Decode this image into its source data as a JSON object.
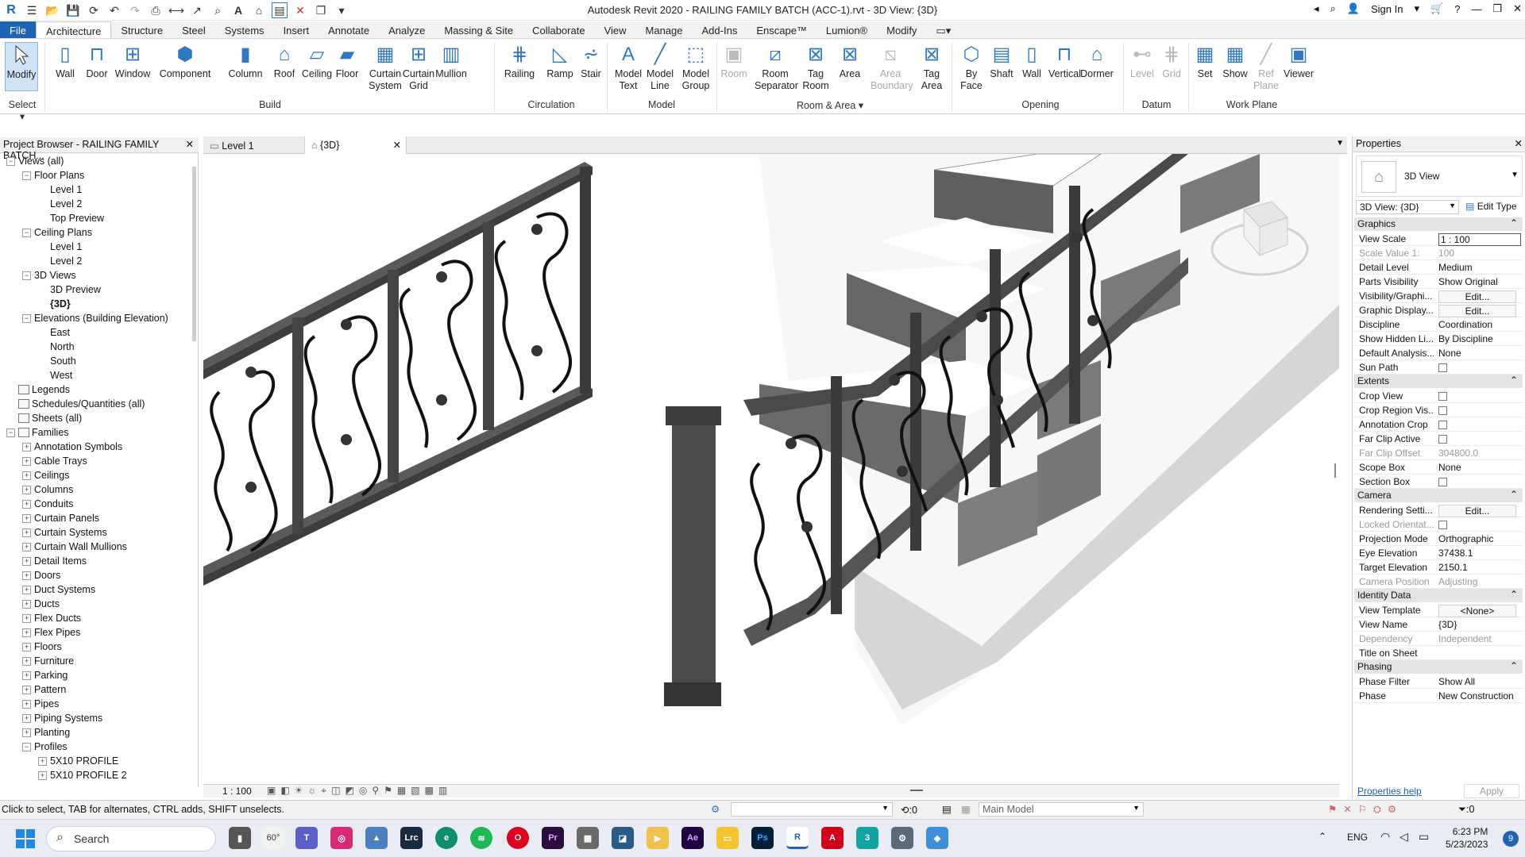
{
  "app": {
    "title": "Autodesk Revit 2020 - RAILING FAMILY BATCH (ACC-1).rvt - 3D View: {3D}",
    "sign_in": "Sign In"
  },
  "ribbon_tabs": [
    "File",
    "Architecture",
    "Structure",
    "Steel",
    "Systems",
    "Insert",
    "Annotate",
    "Analyze",
    "Massing & Site",
    "Collaborate",
    "View",
    "Manage",
    "Add-Ins",
    "Enscape™",
    "Lumion®",
    "Modify"
  ],
  "ribbon": {
    "select_label": "Select",
    "modify": "Modify",
    "build": {
      "label": "Build",
      "tools": [
        "Wall",
        "Door",
        "Window",
        "Component",
        "Column",
        "Roof",
        "Ceiling",
        "Floor",
        "Curtain System",
        "Curtain Grid",
        "Mullion"
      ]
    },
    "circulation": {
      "label": "Circulation",
      "tools": [
        "Railing",
        "Ramp",
        "Stair"
      ]
    },
    "model": {
      "label": "Model",
      "tools": [
        "Model Text",
        "Model Line",
        "Model Group"
      ]
    },
    "room_area": {
      "label": "Room & Area",
      "tools": [
        "Room",
        "Room Separator",
        "Tag Room",
        "Area",
        "Area Boundary",
        "Tag Area"
      ]
    },
    "opening": {
      "label": "Opening",
      "tools": [
        "By Face",
        "Shaft",
        "Wall",
        "Vertical",
        "Dormer"
      ]
    },
    "datum": {
      "label": "Datum",
      "tools": [
        "Level",
        "Grid"
      ]
    },
    "work_plane": {
      "label": "Work Plane",
      "tools": [
        "Set",
        "Show",
        "Ref Plane",
        "Viewer"
      ]
    }
  },
  "project_browser": {
    "title": "Project Browser - RAILING FAMILY BATCH...",
    "tree": [
      {
        "label": "Views (all)",
        "level": 0,
        "exp": "-"
      },
      {
        "label": "Floor Plans",
        "level": 1,
        "exp": "-"
      },
      {
        "label": "Level 1",
        "level": 2,
        "exp": ""
      },
      {
        "label": "Level 2",
        "level": 2,
        "exp": ""
      },
      {
        "label": "Top Preview",
        "level": 2,
        "exp": ""
      },
      {
        "label": "Ceiling Plans",
        "level": 1,
        "exp": "-"
      },
      {
        "label": "Level 1",
        "level": 2,
        "exp": ""
      },
      {
        "label": "Level 2",
        "level": 2,
        "exp": ""
      },
      {
        "label": "3D Views",
        "level": 1,
        "exp": "-"
      },
      {
        "label": "3D Preview",
        "level": 2,
        "exp": ""
      },
      {
        "label": "{3D}",
        "level": 2,
        "exp": "",
        "bold": true
      },
      {
        "label": "Elevations (Building Elevation)",
        "level": 1,
        "exp": "-"
      },
      {
        "label": "East",
        "level": 2,
        "exp": ""
      },
      {
        "label": "North",
        "level": 2,
        "exp": ""
      },
      {
        "label": "South",
        "level": 2,
        "exp": ""
      },
      {
        "label": "West",
        "level": 2,
        "exp": ""
      },
      {
        "label": "Legends",
        "level": 0,
        "exp": "",
        "icon": true
      },
      {
        "label": "Schedules/Quantities (all)",
        "level": 0,
        "exp": "",
        "icon": true
      },
      {
        "label": "Sheets (all)",
        "level": 0,
        "exp": "",
        "icon": true
      },
      {
        "label": "Families",
        "level": 0,
        "exp": "-",
        "icon": true
      },
      {
        "label": "Annotation Symbols",
        "level": 1,
        "exp": "+"
      },
      {
        "label": "Cable Trays",
        "level": 1,
        "exp": "+"
      },
      {
        "label": "Ceilings",
        "level": 1,
        "exp": "+"
      },
      {
        "label": "Columns",
        "level": 1,
        "exp": "+"
      },
      {
        "label": "Conduits",
        "level": 1,
        "exp": "+"
      },
      {
        "label": "Curtain Panels",
        "level": 1,
        "exp": "+"
      },
      {
        "label": "Curtain Systems",
        "level": 1,
        "exp": "+"
      },
      {
        "label": "Curtain Wall Mullions",
        "level": 1,
        "exp": "+"
      },
      {
        "label": "Detail Items",
        "level": 1,
        "exp": "+"
      },
      {
        "label": "Doors",
        "level": 1,
        "exp": "+"
      },
      {
        "label": "Duct Systems",
        "level": 1,
        "exp": "+"
      },
      {
        "label": "Ducts",
        "level": 1,
        "exp": "+"
      },
      {
        "label": "Flex Ducts",
        "level": 1,
        "exp": "+"
      },
      {
        "label": "Flex Pipes",
        "level": 1,
        "exp": "+"
      },
      {
        "label": "Floors",
        "level": 1,
        "exp": "+"
      },
      {
        "label": "Furniture",
        "level": 1,
        "exp": "+"
      },
      {
        "label": "Parking",
        "level": 1,
        "exp": "+"
      },
      {
        "label": "Pattern",
        "level": 1,
        "exp": "+"
      },
      {
        "label": "Pipes",
        "level": 1,
        "exp": "+"
      },
      {
        "label": "Piping Systems",
        "level": 1,
        "exp": "+"
      },
      {
        "label": "Planting",
        "level": 1,
        "exp": "+"
      },
      {
        "label": "Profiles",
        "level": 1,
        "exp": "-"
      },
      {
        "label": "5X10 PROFILE",
        "level": 2,
        "exp": "+"
      },
      {
        "label": "5X10 PROFILE 2",
        "level": 2,
        "exp": "+"
      }
    ]
  },
  "view_tabs": [
    {
      "label": "Level 1",
      "active": false
    },
    {
      "label": "{3D}",
      "active": true
    }
  ],
  "view_bar": {
    "scale": "1 : 100"
  },
  "properties": {
    "title": "Properties",
    "type_name": "3D View",
    "selector": "3D View: {3D}",
    "edit_type": "Edit Type",
    "sections": [
      {
        "name": "Graphics",
        "rows": [
          {
            "k": "View Scale",
            "v": "1 : 100",
            "kind": "input"
          },
          {
            "k": "Scale Value    1:",
            "v": "100",
            "dim": true
          },
          {
            "k": "Detail Level",
            "v": "Medium"
          },
          {
            "k": "Parts Visibility",
            "v": "Show Original"
          },
          {
            "k": "Visibility/Graphi...",
            "v": "Edit...",
            "kind": "button"
          },
          {
            "k": "Graphic Display...",
            "v": "Edit...",
            "kind": "button"
          },
          {
            "k": "Discipline",
            "v": "Coordination"
          },
          {
            "k": "Show Hidden Li...",
            "v": "By Discipline"
          },
          {
            "k": "Default Analysis...",
            "v": "None"
          },
          {
            "k": "Sun Path",
            "v": "",
            "kind": "check"
          }
        ]
      },
      {
        "name": "Extents",
        "rows": [
          {
            "k": "Crop View",
            "v": "",
            "kind": "check"
          },
          {
            "k": "Crop Region Vis...",
            "v": "",
            "kind": "check"
          },
          {
            "k": "Annotation Crop",
            "v": "",
            "kind": "check"
          },
          {
            "k": "Far Clip Active",
            "v": "",
            "kind": "check"
          },
          {
            "k": "Far Clip Offset",
            "v": "304800.0",
            "dim": true
          },
          {
            "k": "Scope Box",
            "v": "None"
          },
          {
            "k": "Section Box",
            "v": "",
            "kind": "check"
          }
        ]
      },
      {
        "name": "Camera",
        "rows": [
          {
            "k": "Rendering Setti...",
            "v": "Edit...",
            "kind": "button"
          },
          {
            "k": "Locked Orientat...",
            "v": "",
            "kind": "check",
            "dim": true
          },
          {
            "k": "Projection Mode",
            "v": "Orthographic"
          },
          {
            "k": "Eye Elevation",
            "v": "37438.1"
          },
          {
            "k": "Target Elevation",
            "v": "2150.1"
          },
          {
            "k": "Camera Position",
            "v": "Adjusting",
            "dim": true
          }
        ]
      },
      {
        "name": "Identity Data",
        "rows": [
          {
            "k": "View Template",
            "v": "<None>",
            "kind": "button"
          },
          {
            "k": "View Name",
            "v": "{3D}"
          },
          {
            "k": "Dependency",
            "v": "Independent",
            "dim": true
          },
          {
            "k": "Title on Sheet",
            "v": ""
          }
        ]
      },
      {
        "name": "Phasing",
        "rows": [
          {
            "k": "Phase Filter",
            "v": "Show All"
          },
          {
            "k": "Phase",
            "v": "New Construction"
          }
        ]
      }
    ],
    "help_link": "Properties help",
    "apply": "Apply"
  },
  "status_bar": {
    "hint": "Click to select, TAB for alternates, CTRL adds, SHIFT unselects.",
    "workset": ":0",
    "model": "Main Model",
    "filter_count": ":0"
  },
  "taskbar": {
    "search_placeholder": "Search",
    "weather": "60°",
    "lang": "ENG",
    "time": "6:23 PM",
    "date": "5/23/2023",
    "badge": "9"
  },
  "colors": {
    "file_tab": "#1e64b4",
    "ribbon_icon_blue": "#2f78c4",
    "railing_dark": "#3a3a3a",
    "stair_gray": "#8c8c8c"
  }
}
